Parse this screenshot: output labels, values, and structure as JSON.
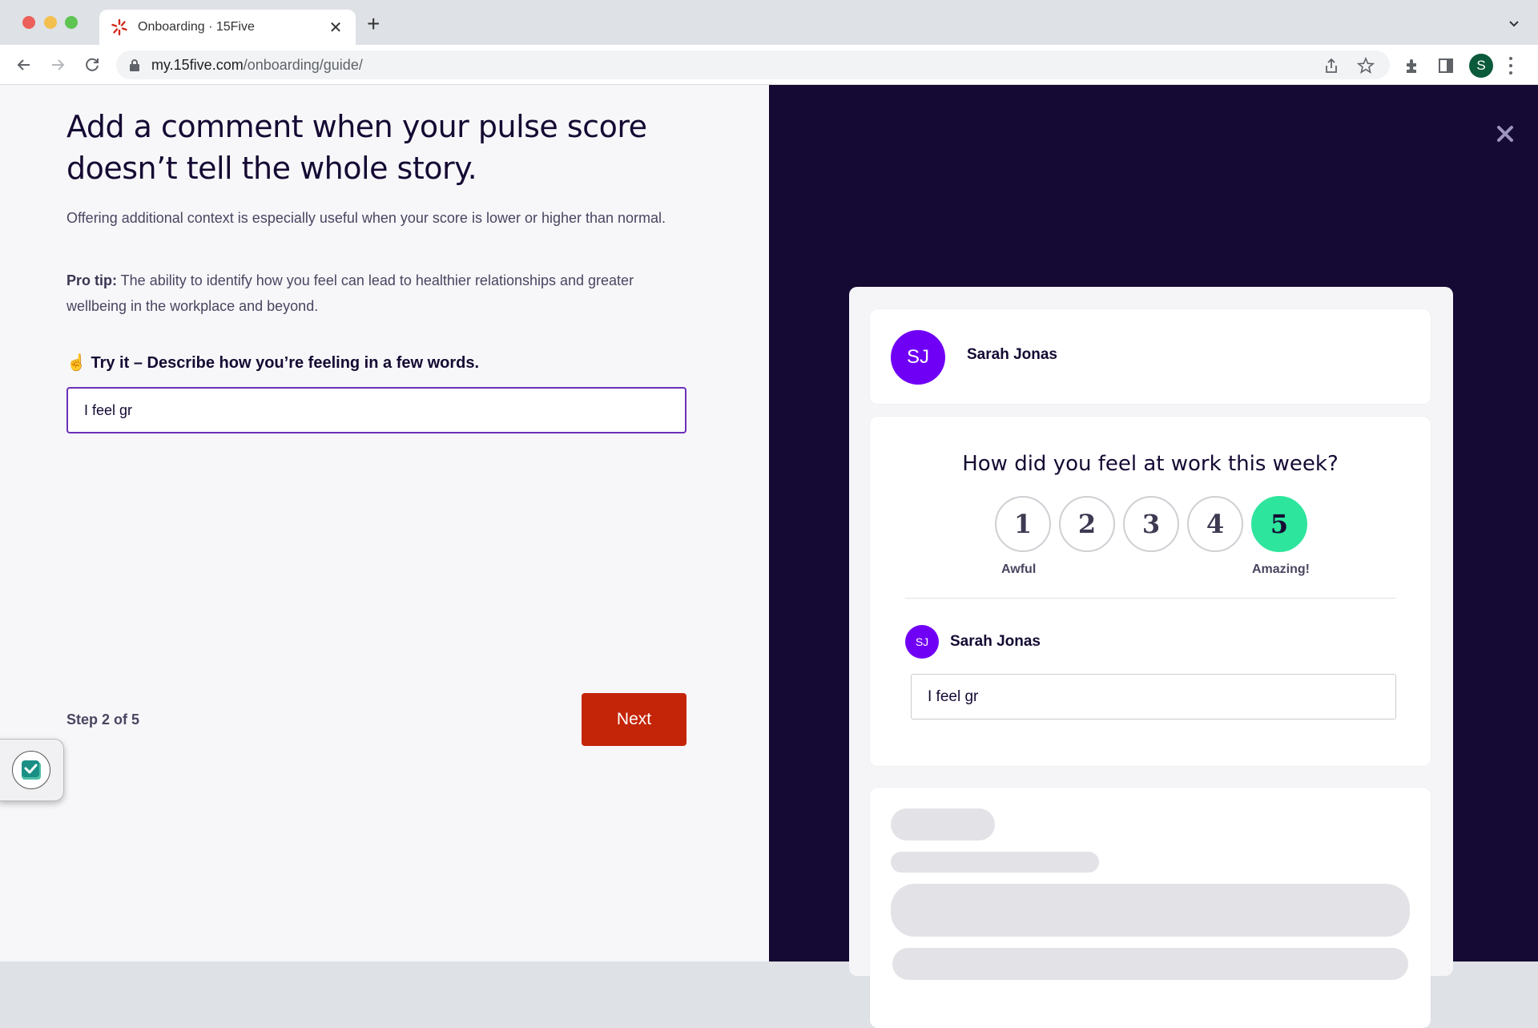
{
  "browser": {
    "tab": {
      "title": "Onboarding · 15Five",
      "favicon": "15five-logo-icon"
    },
    "url": {
      "host": "my.15five.com",
      "path": "/onboarding/guide/"
    },
    "profile_initial": "S",
    "icons": [
      "back-arrow-icon",
      "forward-arrow-icon",
      "reload-icon",
      "lock-icon",
      "share-icon",
      "bookmark-star-icon",
      "extensions-puzzle-icon",
      "side-panel-icon",
      "kebab-menu-icon",
      "tab-dropdown-icon"
    ]
  },
  "guide": {
    "heading": "Add a comment when your pulse score doesn’t tell the whole story.",
    "description": "Offering additional context is especially useful when your score is lower or higher than normal.",
    "protip_label": "Pro tip:",
    "protip_text": " The ability to identify how you feel can lead to healthier relationships and greater wellbeing in the workplace and beyond.",
    "try_emoji": "☝️",
    "try_label": "Try it – Describe how you’re feeling in a few words.",
    "input_value": "I feel gr",
    "step": "Step 2 of 5",
    "next_label": "Next"
  },
  "preview": {
    "user": {
      "initials": "SJ",
      "name": "Sarah Jonas"
    },
    "question": "How did you feel at work this week?",
    "scores": [
      "1",
      "2",
      "3",
      "4",
      "5"
    ],
    "selected_score": 5,
    "scale_low": "Awful",
    "scale_high": "Amazing!",
    "comment": {
      "initials": "SJ",
      "name": "Sarah Jonas",
      "text": "I feel gr"
    }
  },
  "colors": {
    "brand_red": "#c42508",
    "avatar_purple": "#7000f5",
    "selected_green": "#2ee59d",
    "dark_panel": "#150a33",
    "input_border": "#6b2fb8"
  }
}
